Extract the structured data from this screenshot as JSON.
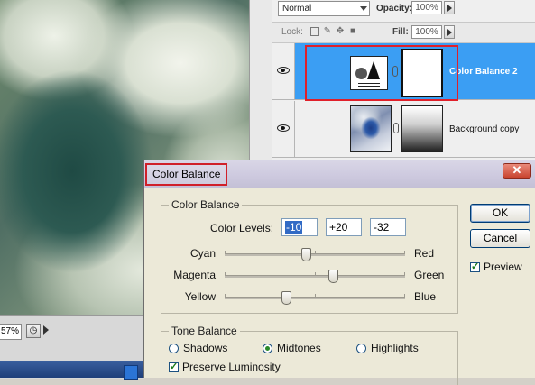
{
  "canvas": {
    "zoom": "57%"
  },
  "layers_panel": {
    "blend_mode": "Normal",
    "opacity_label": "Opacity:",
    "opacity_value": "100%",
    "lock_label": "Lock:",
    "fill_label": "Fill:",
    "fill_value": "100%",
    "layers": [
      {
        "name": "Color Balance 2",
        "selected": true,
        "visible": true
      },
      {
        "name": "Background copy",
        "selected": false,
        "visible": true
      }
    ]
  },
  "dialog": {
    "title": "Color Balance",
    "close_glyph": "✕",
    "color_balance_group": "Color Balance",
    "color_levels_label": "Color Levels:",
    "levels": [
      "-10",
      "+20",
      "-32"
    ],
    "sliders": [
      {
        "left": "Cyan",
        "right": "Red",
        "value": -10
      },
      {
        "left": "Magenta",
        "right": "Green",
        "value": 20
      },
      {
        "left": "Yellow",
        "right": "Blue",
        "value": -32
      }
    ],
    "slider_range": [
      -100,
      100
    ],
    "tone_balance_group": "Tone Balance",
    "tone_options": [
      "Shadows",
      "Midtones",
      "Highlights"
    ],
    "selected_tone": "Midtones",
    "preserve_luminosity_label": "Preserve Luminosity",
    "preserve_luminosity": true,
    "ok_label": "OK",
    "cancel_label": "Cancel",
    "preview_label": "Preview",
    "preview": true
  },
  "colors": {
    "selection_blue": "#3b9ef3",
    "highlight_red": "#e0202a"
  }
}
